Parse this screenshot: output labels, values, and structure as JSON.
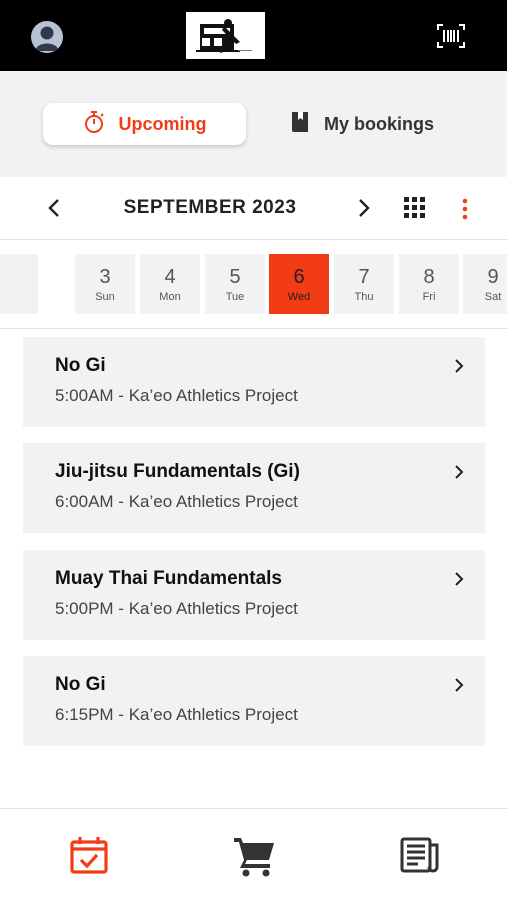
{
  "header": {
    "avatar_icon": "user-avatar-icon",
    "logo_icon": "kaeo-logo",
    "barcode_icon": "barcode-icon"
  },
  "segments": {
    "upcoming_label": "Upcoming",
    "upcoming_icon": "stopwatch-icon",
    "bookings_label": "My bookings",
    "bookings_icon": "bookmark-book-icon"
  },
  "calendar": {
    "month_title": "SEPTEMBER 2023",
    "prev_icon": "chevron-left-icon",
    "next_icon": "chevron-right-icon",
    "grid_icon": "grid-icon",
    "more_icon": "more-vertical-icon",
    "days": [
      {
        "num": "3",
        "dow": "Sun"
      },
      {
        "num": "4",
        "dow": "Mon"
      },
      {
        "num": "5",
        "dow": "Tue"
      },
      {
        "num": "6",
        "dow": "Wed"
      },
      {
        "num": "7",
        "dow": "Thu"
      },
      {
        "num": "8",
        "dow": "Fri"
      },
      {
        "num": "9",
        "dow": "Sat"
      }
    ],
    "selected_day": "6"
  },
  "classes": [
    {
      "title": "No Gi",
      "subtitle": "5:00AM - Ka’eo Athletics Project"
    },
    {
      "title": "Jiu-jitsu Fundamentals (Gi)",
      "subtitle": "6:00AM - Ka’eo Athletics Project"
    },
    {
      "title": "Muay Thai Fundamentals",
      "subtitle": "5:00PM - Ka’eo Athletics Project"
    },
    {
      "title": "No Gi",
      "subtitle": "6:15PM - Ka’eo Athletics Project"
    }
  ],
  "bottom_nav": {
    "items": [
      "calendar-check-icon",
      "cart-icon",
      "newspaper-icon"
    ],
    "active_color": "#f23c15"
  },
  "colors": {
    "accent": "#f23c15",
    "topbar": "#000000",
    "card_bg": "#f2f2f2"
  }
}
